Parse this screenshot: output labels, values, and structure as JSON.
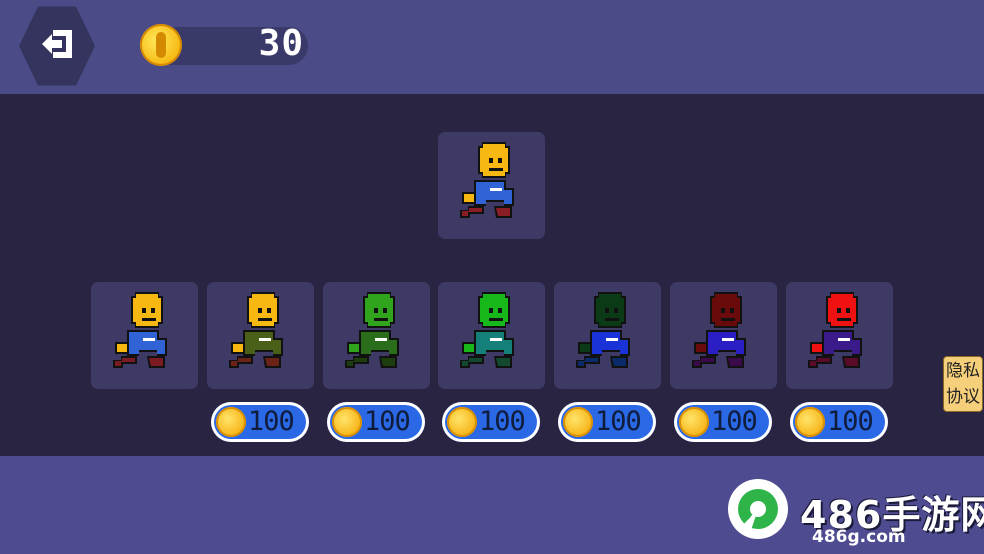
{
  "header": {
    "exit_icon": "exit-arrow-icon",
    "coin_icon": "gold-coin-icon",
    "coins": "30"
  },
  "selected": {
    "character": {
      "head": "#f7b811",
      "body": "#2f63d6",
      "shade": "#8a1e26"
    }
  },
  "characters": [
    {
      "head": "#f7b811",
      "body": "#2f63d6",
      "shade": "#7a1a22",
      "price": ""
    },
    {
      "head": "#f7b811",
      "body": "#4a5f17",
      "shade": "#6b2318",
      "price": "100"
    },
    {
      "head": "#2fa41c",
      "body": "#2a6e1c",
      "shade": "#1d3d0f",
      "price": "100"
    },
    {
      "head": "#16b81a",
      "body": "#15807a",
      "shade": "#12492f",
      "price": "100"
    },
    {
      "head": "#0b3a16",
      "body": "#1a33d8",
      "shade": "#0a2a6a",
      "price": "100"
    },
    {
      "head": "#6a0b0b",
      "body": "#2a1fc4",
      "shade": "#3b0a4a",
      "price": "100"
    },
    {
      "head": "#f01212",
      "body": "#3b1b8a",
      "shade": "#5b0b2a",
      "price": "100"
    }
  ],
  "privacy": {
    "line1": "隐私",
    "line2": "协议"
  },
  "watermark": {
    "brand": "486手游网",
    "url": "486g.com"
  },
  "colors": {
    "topbar": "#4b4b88",
    "arena": "#2a2443",
    "bottom": "#4f4b91",
    "price_pill": "#2a68e6"
  }
}
